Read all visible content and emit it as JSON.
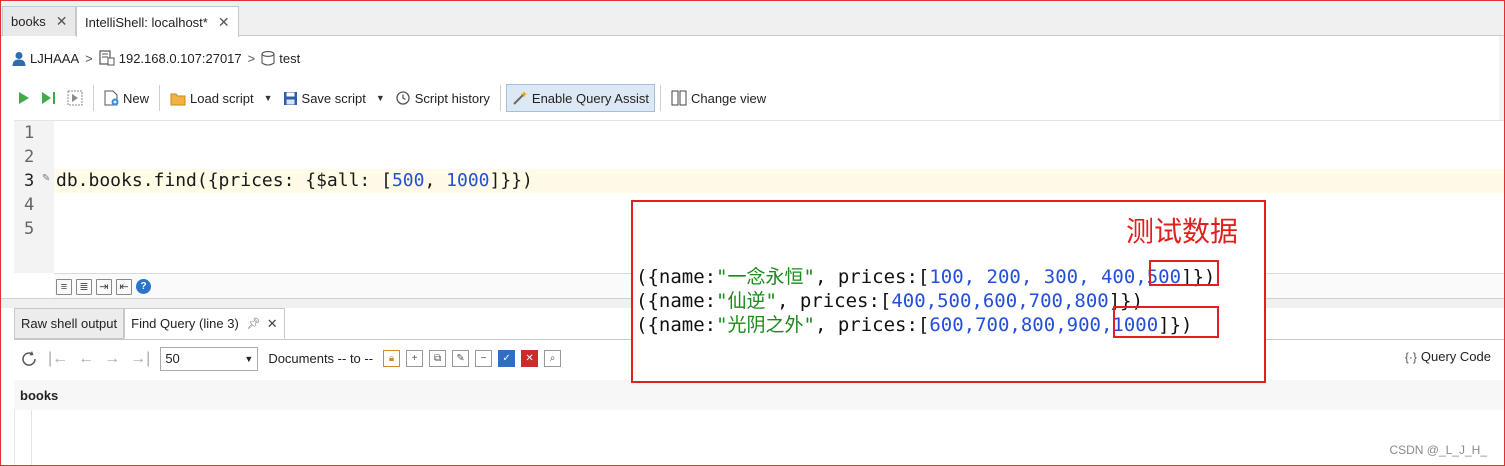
{
  "tabs": [
    {
      "label": "books",
      "close": "✕"
    },
    {
      "label": "IntelliShell: localhost*",
      "close": "✕"
    }
  ],
  "breadcrumb": {
    "user": "LJHAAA",
    "server": "192.168.0.107:27017",
    "database": "test",
    "separator": ">"
  },
  "toolbar": {
    "new": "New",
    "load_script": "Load script",
    "save_script": "Save script",
    "script_history": "Script history",
    "enable_query_assist": "Enable Query Assist",
    "change_view": "Change view"
  },
  "editor": {
    "line_numbers": [
      "1",
      "2",
      "3",
      "4",
      "5"
    ],
    "code_prefix": "db.books.find({prices: {$all: [",
    "code_num1": "500",
    "code_mid": ", ",
    "code_num2": "1000",
    "code_suffix": "]}})"
  },
  "results": {
    "tab_raw": "Raw shell output",
    "tab_find": "Find Query (line 3)",
    "page_size": "50",
    "documents_label": "Documents -- to --",
    "query_code": "Query Code",
    "collection": "books"
  },
  "overlay": {
    "title": "测试数据",
    "rows": [
      {
        "prefix": "({name:",
        "name": "\"一念永恒\"",
        "mid": ", prices:[",
        "values": "100, 200, 300, 400,",
        "highlight": "500",
        "suffix": "]})"
      },
      {
        "prefix": "({name:",
        "name": "\"仙逆\"",
        "mid": ", prices:[",
        "values": "400,500,600,700,800",
        "highlight": "",
        "suffix": "]})"
      },
      {
        "prefix": "({name:",
        "name": "\"光阴之外\"",
        "mid": ", prices:[",
        "values": "600,700,800,900,",
        "highlight": "1000",
        "suffix": "]})"
      }
    ]
  },
  "watermark": "CSDN @_L_J_H_"
}
